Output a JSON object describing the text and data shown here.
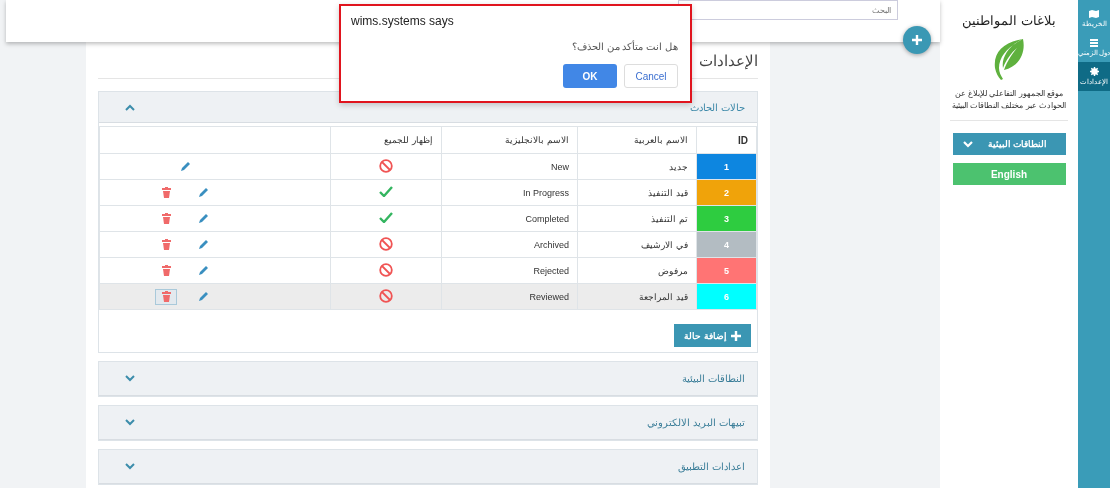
{
  "nav": {
    "items": [
      {
        "label": "الخريطة",
        "selected": false
      },
      {
        "label": "دول الزمني",
        "selected": false
      },
      {
        "label": "الإعدادات",
        "selected": true
      }
    ]
  },
  "sidebar": {
    "title": "بلاغات المواطنين",
    "description": "موقع الجمهور التفاعلي للإبلاغ عن الحوادث عبر مختلف النطاقات البيئية",
    "dropdown": "النطاقات البيئية",
    "language_button": "English"
  },
  "topbar": {
    "search": {
      "placeholder": "البحث"
    }
  },
  "page": {
    "title": "الإعدادات",
    "sections": [
      {
        "title": "حالات الحادث",
        "expanded": true,
        "table": {
          "columns": [
            "ID",
            "الاسم بالعربية",
            "الاسم بالانجليزية",
            "إظهار للجميع"
          ],
          "rows": [
            {
              "id": "1",
              "color": "#0d86e0",
              "name_ar": "جديد",
              "name_en": "New",
              "visible_to_all": false,
              "deletable": false,
              "selected": false
            },
            {
              "id": "2",
              "color": "#f0a30a",
              "name_ar": "قيد التنفيذ",
              "name_en": "In Progress",
              "visible_to_all": true,
              "deletable": true,
              "selected": false
            },
            {
              "id": "3",
              "color": "#2ecc40",
              "name_ar": "تم التنفيذ",
              "name_en": "Completed",
              "visible_to_all": true,
              "deletable": true,
              "selected": false
            },
            {
              "id": "4",
              "color": "#b3bcc2",
              "name_ar": "في الارشيف",
              "name_en": "Archived",
              "visible_to_all": false,
              "deletable": true,
              "selected": false
            },
            {
              "id": "5",
              "color": "#ff7474",
              "name_ar": "مرفوض",
              "name_en": "Rejected",
              "visible_to_all": false,
              "deletable": true,
              "selected": false
            },
            {
              "id": "6",
              "color": "#00ffff",
              "name_ar": "قيد المراجعة",
              "name_en": "Reviewed",
              "visible_to_all": false,
              "deletable": true,
              "selected": true
            }
          ]
        },
        "add_button": "إضافة حالة"
      },
      {
        "title": "النطاقات البيئية",
        "expanded": false
      },
      {
        "title": "تبيهات البريد الالكتروني",
        "expanded": false
      },
      {
        "title": "اعدادات التطبيق",
        "expanded": false
      }
    ]
  },
  "dialog": {
    "title": "wims.systems says",
    "message": "هل انت متأكد من الحذف؟",
    "buttons": [
      {
        "label": "Cancel",
        "kind": "secondary"
      },
      {
        "label": "OK",
        "kind": "primary"
      }
    ]
  }
}
